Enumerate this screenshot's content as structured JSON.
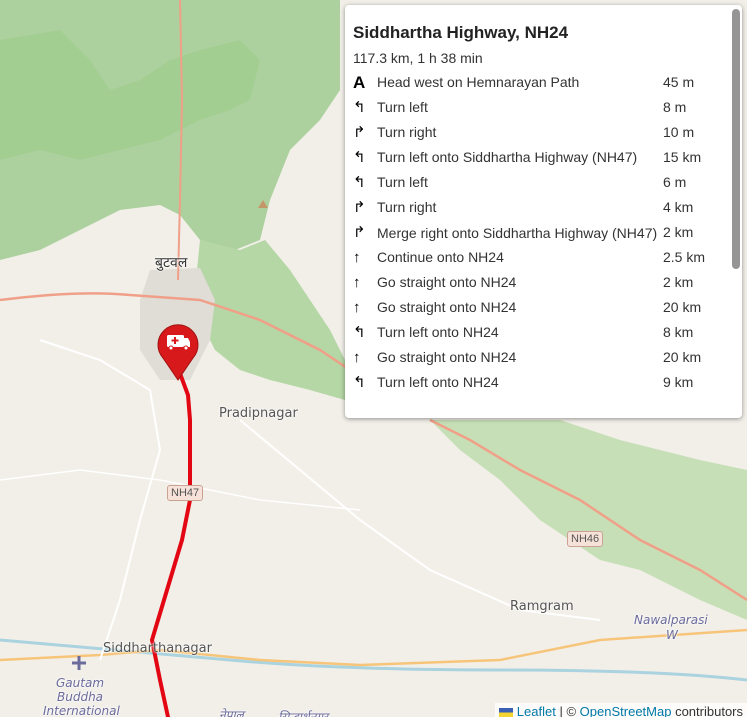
{
  "map": {
    "labels": {
      "butwal": "बुटवल",
      "pradipnagar": "Pradipnagar",
      "ramgram": "Ramgram",
      "siddharthanagar": "Siddharthanagar",
      "nawalparasi": "Nawalparasi",
      "nawalparasi2": "W",
      "gautam1": "Gautam",
      "gautam2": "Buddha",
      "gautam3": "International",
      "nepal_bottom": "नेपाल",
      "bottom_text2": "सिद्धार्थनगर"
    },
    "shields": {
      "nh47": "NH47",
      "nh46": "NH46"
    },
    "colors": {
      "route": "#e30613",
      "marker": "#d7191c",
      "forest": "#add19e",
      "land": "#f2efe9"
    }
  },
  "marker": {
    "icon": "ambulance-icon"
  },
  "directions": {
    "title": "Siddhartha Highway, NH24",
    "summary": "117.3 km, 1 h 38 min",
    "steps": [
      {
        "icon": "depart-icon",
        "glyph": "A",
        "text": "Head west on Hemnarayan Path",
        "distance": "45 m"
      },
      {
        "icon": "turn-left-icon",
        "glyph": "↰",
        "text": "Turn left",
        "distance": "8 m"
      },
      {
        "icon": "turn-right-icon",
        "glyph": "↱",
        "text": "Turn right",
        "distance": "10 m"
      },
      {
        "icon": "turn-left-icon",
        "glyph": "↰",
        "text": "Turn left onto Siddhartha Highway (NH47)",
        "distance": "15 km"
      },
      {
        "icon": "turn-left-icon",
        "glyph": "↰",
        "text": "Turn left",
        "distance": "6 m"
      },
      {
        "icon": "turn-right-icon",
        "glyph": "↱",
        "text": "Turn right",
        "distance": "4 km"
      },
      {
        "icon": "merge-right-icon",
        "glyph": "↱",
        "text": "Merge right onto Siddhartha Highway (NH47)",
        "distance": "2 km"
      },
      {
        "icon": "continue-icon",
        "glyph": "↑",
        "text": "Continue onto NH24",
        "distance": "2.5 km"
      },
      {
        "icon": "straight-icon",
        "glyph": "↑",
        "text": "Go straight onto NH24",
        "distance": "2 km"
      },
      {
        "icon": "straight-icon",
        "glyph": "↑",
        "text": "Go straight onto NH24",
        "distance": "20 km"
      },
      {
        "icon": "turn-left-icon",
        "glyph": "↰",
        "text": "Turn left onto NH24",
        "distance": "8 km"
      },
      {
        "icon": "straight-icon",
        "glyph": "↑",
        "text": "Go straight onto NH24",
        "distance": "20 km"
      },
      {
        "icon": "turn-left-icon",
        "glyph": "↰",
        "text": "Turn left onto NH24",
        "distance": "9 km"
      }
    ]
  },
  "attribution": {
    "leaflet": "Leaflet",
    "separator": "| ©",
    "osm": "OpenStreetMap",
    "suffix": "contributors"
  }
}
